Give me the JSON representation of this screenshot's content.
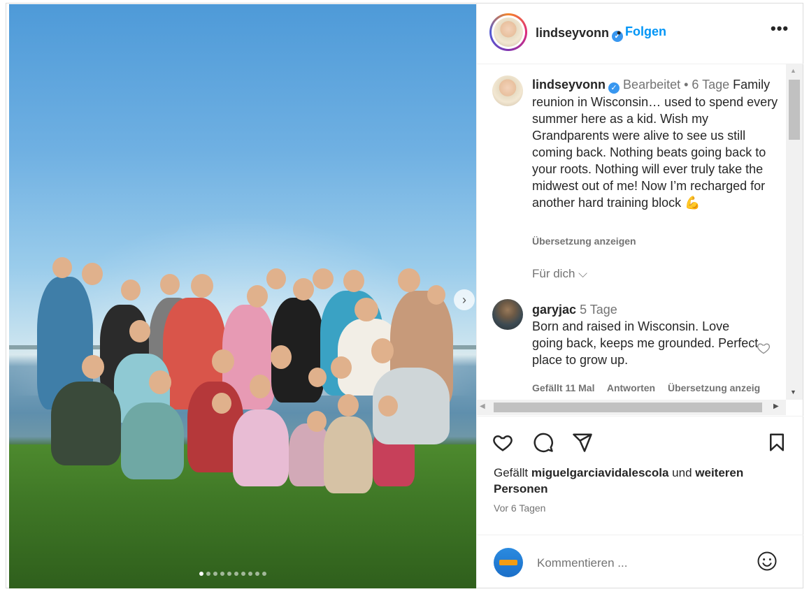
{
  "header": {
    "username": "lindseyvonn",
    "verified_icon": "verified-check",
    "separator": "•",
    "follow_label": "Folgen",
    "more_label": "•••"
  },
  "caption": {
    "username": "lindseyvonn",
    "meta": "Bearbeitet • 6 Tage",
    "text": "Family reunion in Wisconsin… used to spend every summer here as a kid. Wish my Grandparents were alive to see us still coming back. Nothing beats going back to your roots. Nothing will ever truly take the midwest out of me! Now I’m recharged for another hard training block 💪",
    "translate_label": "Übersetzung anzeigen",
    "for_you_label": "Für dich ⌵"
  },
  "comment": {
    "username": "garyjac",
    "time": "5 Tage",
    "text": "Born and raised in Wisconsin. Love going back, keeps me grounded. Perfect place to grow up.",
    "likes_label": "Gefällt 11 Mal",
    "reply_label": "Antworten",
    "translate_label": "Übersetzung anzeig"
  },
  "likes": {
    "prefix": "Gefällt",
    "user": "miguelgarciavidalescola",
    "connector": "und",
    "rest": "weiteren Personen"
  },
  "timestamp": "Vor 6 Tagen",
  "comment_input": {
    "placeholder": "Kommentieren ..."
  },
  "carousel": {
    "total_slides": 10,
    "active_slide": 1,
    "next_label": "›"
  },
  "colors": {
    "accent": "#0095f6",
    "verified": "#3897f0",
    "text": "#262626",
    "muted": "#737373"
  },
  "icons": [
    "heart-icon",
    "comment-icon",
    "share-icon",
    "bookmark-icon",
    "emoji-icon",
    "chevron-right-icon"
  ]
}
